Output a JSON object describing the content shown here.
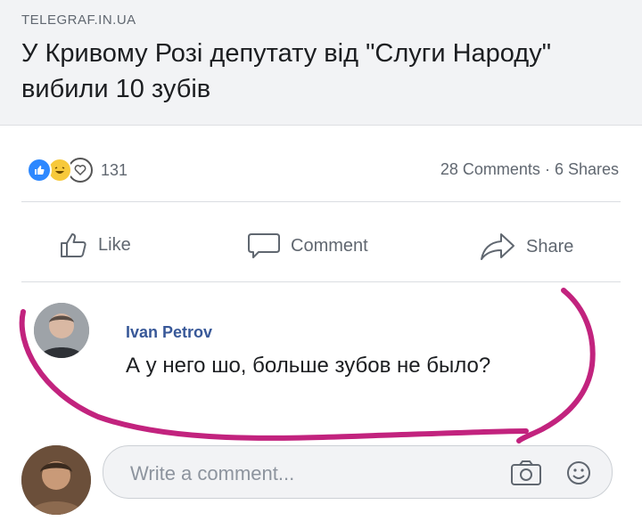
{
  "article": {
    "source": "TELEGRAF.IN.UA",
    "headline": "У Кривому Розі депутату від \"Слуги Народу\" вибили 10 зубів"
  },
  "reactions": {
    "count": "131",
    "types": [
      "like-icon",
      "haha-icon",
      "love-icon"
    ],
    "colors": {
      "like": "#2d88ff",
      "haha": "#f7c93b"
    }
  },
  "stats": {
    "comments": "28 Comments",
    "separator": "·",
    "shares": "6 Shares"
  },
  "actions": {
    "like": "Like",
    "comment": "Comment",
    "share": "Share"
  },
  "comment": {
    "author": "Ivan Petrov",
    "text": "А у него шо, больше зубов не было?"
  },
  "composer": {
    "placeholder": "Write a comment..."
  },
  "annotation": {
    "color": "#c2237e"
  }
}
